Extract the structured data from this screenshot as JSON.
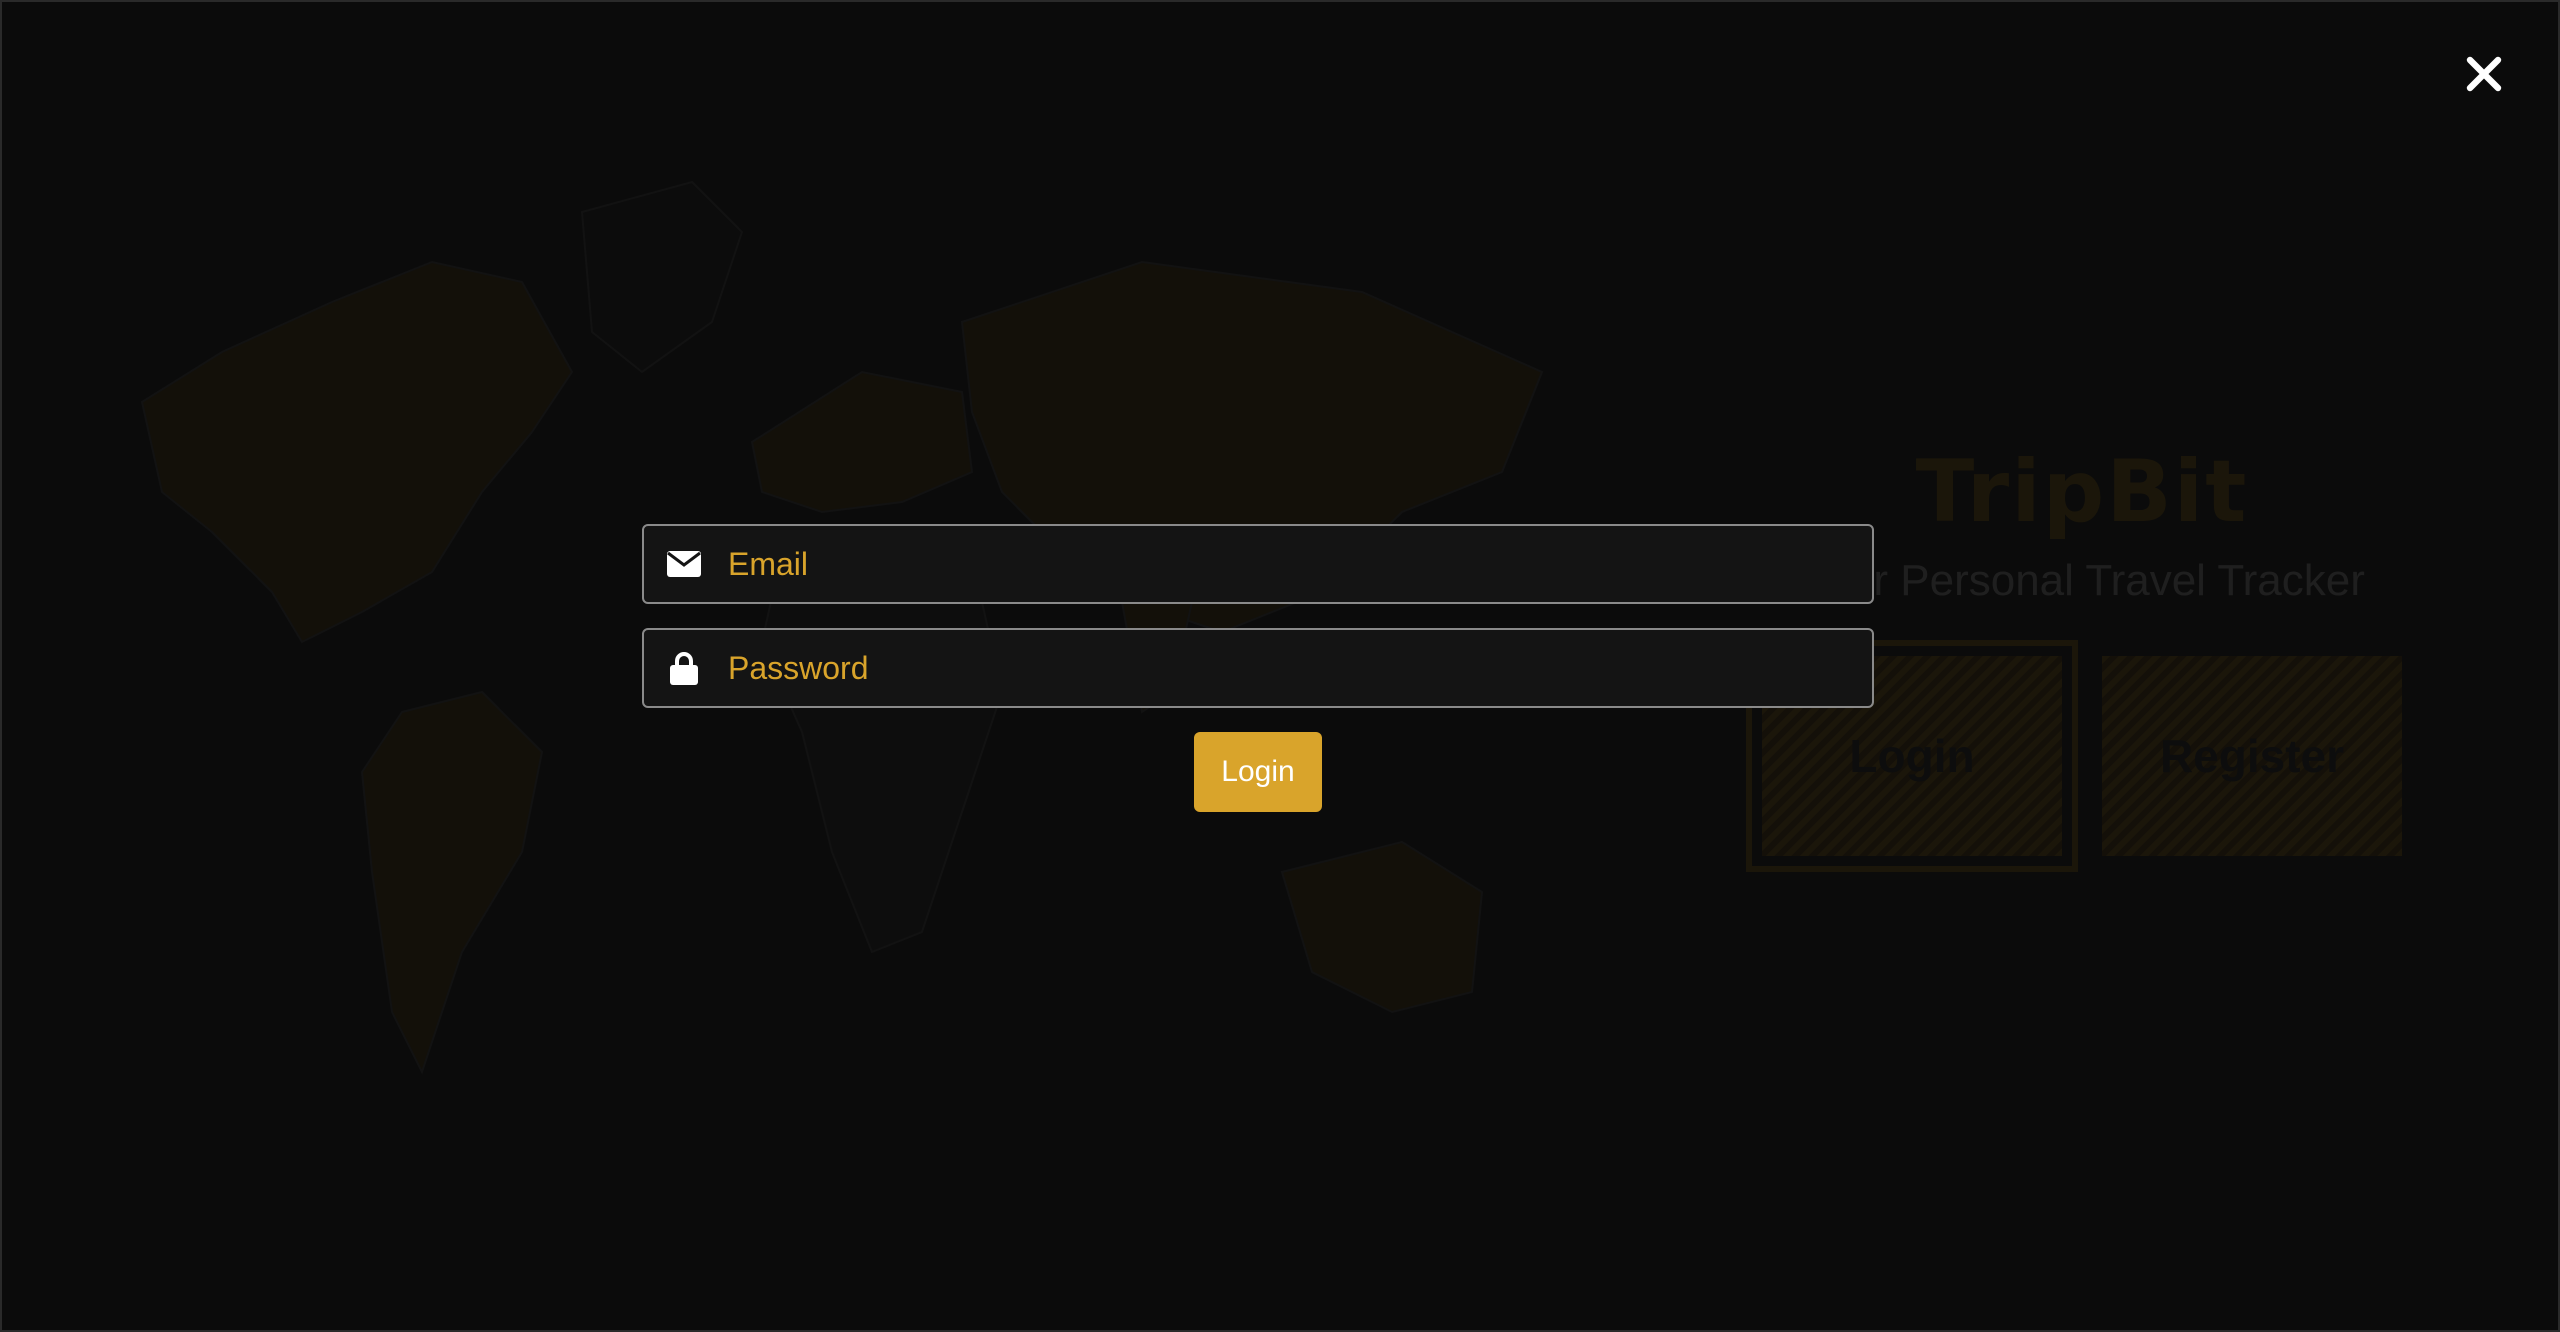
{
  "background": {
    "title": "TripBit",
    "subtitle": "Your Personal Travel Tracker",
    "login_label": "Login",
    "register_label": "Register"
  },
  "modal": {
    "close_icon": "close-icon",
    "email": {
      "icon": "envelope-icon",
      "placeholder": "Email",
      "value": ""
    },
    "password": {
      "icon": "lock-icon",
      "placeholder": "Password",
      "value": ""
    },
    "submit_label": "Login"
  },
  "colors": {
    "accent": "#d9a42b",
    "background": "#111111",
    "field_border": "#8a8a8a"
  }
}
